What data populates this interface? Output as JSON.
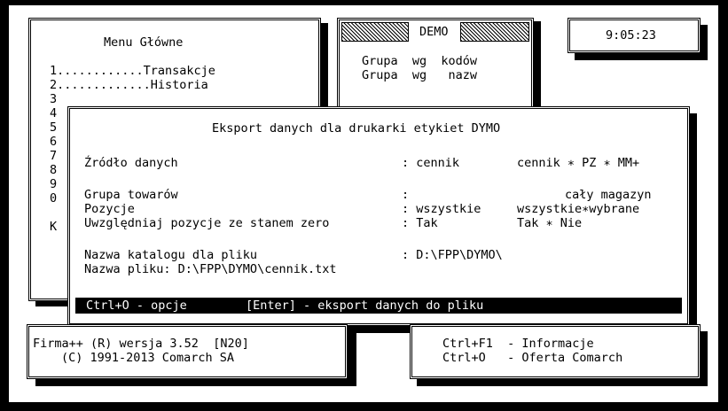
{
  "menu": {
    "title": "Menu Główne",
    "items": [
      "1............Transakcje",
      "2.............Historia",
      "3",
      "4",
      "5",
      "6",
      "7",
      "8",
      "9",
      "0",
      "",
      "K"
    ]
  },
  "demo": {
    "title": "DEMO",
    "lines": [
      "Grupa  wg  kodów",
      "Grupa  wg   nazw"
    ]
  },
  "clock": {
    "time": "9:05:23"
  },
  "dialog": {
    "title": "Eksport danych dla drukarki etykiet DYMO",
    "rows": [
      {
        "label": "Źródło danych",
        "value": ": cennik",
        "options": "cennik ∗ PZ ∗ MM+"
      },
      {
        "label": "Grupa towarów",
        "value": ":",
        "options": "cały magazyn"
      },
      {
        "label": "Pozycje",
        "value": ": wszystkie",
        "options": "wszystkie∗wybrane"
      },
      {
        "label": "Uwzględniaj pozycje ze stanem zero",
        "value": ": Tak",
        "options": "Tak ∗ Nie"
      }
    ],
    "folder_label": "Nazwa katalogu dla pliku",
    "folder_value": ": D:\\FPP\\DYMO\\",
    "file_line": "Nazwa pliku: D:\\FPP\\DYMO\\cennik.txt",
    "footer_left": "Ctrl+O - opcje",
    "footer_right": "[Enter] - eksport danych do pliku"
  },
  "info": {
    "line1": "Firma++ (R) wersja 3.52  [N20]",
    "line2": "(C) 1991-2013 Comarch SA"
  },
  "help": {
    "line1": "Ctrl+F1  - Informacje",
    "line2": "Ctrl+O   - Oferta Comarch"
  }
}
